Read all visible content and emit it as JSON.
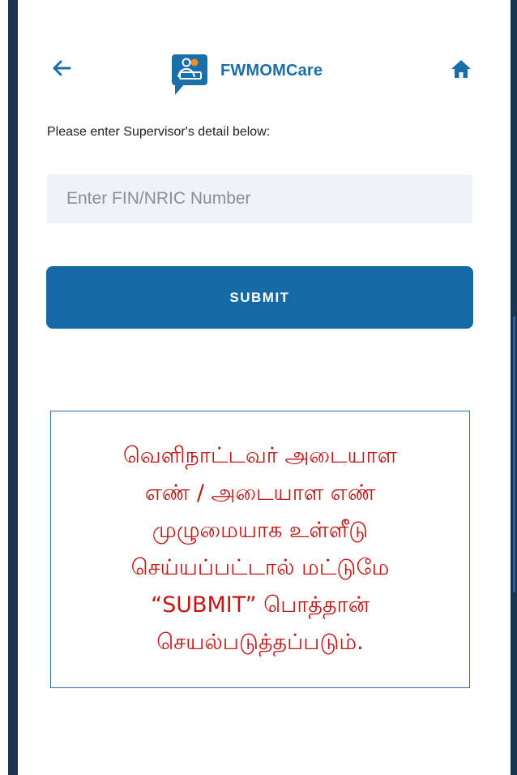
{
  "app": {
    "name": "FWMOMCare",
    "brand_color": "#1b6fa8",
    "header_icons": [
      "back-arrow-icon",
      "home-icon"
    ]
  },
  "form": {
    "prompt": "Please enter Supervisor's detail below:",
    "fin_placeholder": "Enter FIN/NRIC Number",
    "fin_value": "",
    "submit_label": "SUBMIT",
    "button_color": "#156aa5"
  },
  "note": {
    "color": "#c41414",
    "lines": [
      "வெளிநாட்டவர் அடையாள",
      "எண் / அடையாள எண்",
      "முழுமையாக உள்ளீடு",
      "செய்யப்பட்டால் மட்டுமே",
      "“SUBMIT” பொத்தான்",
      "செயல்படுத்தப்படும்."
    ]
  }
}
